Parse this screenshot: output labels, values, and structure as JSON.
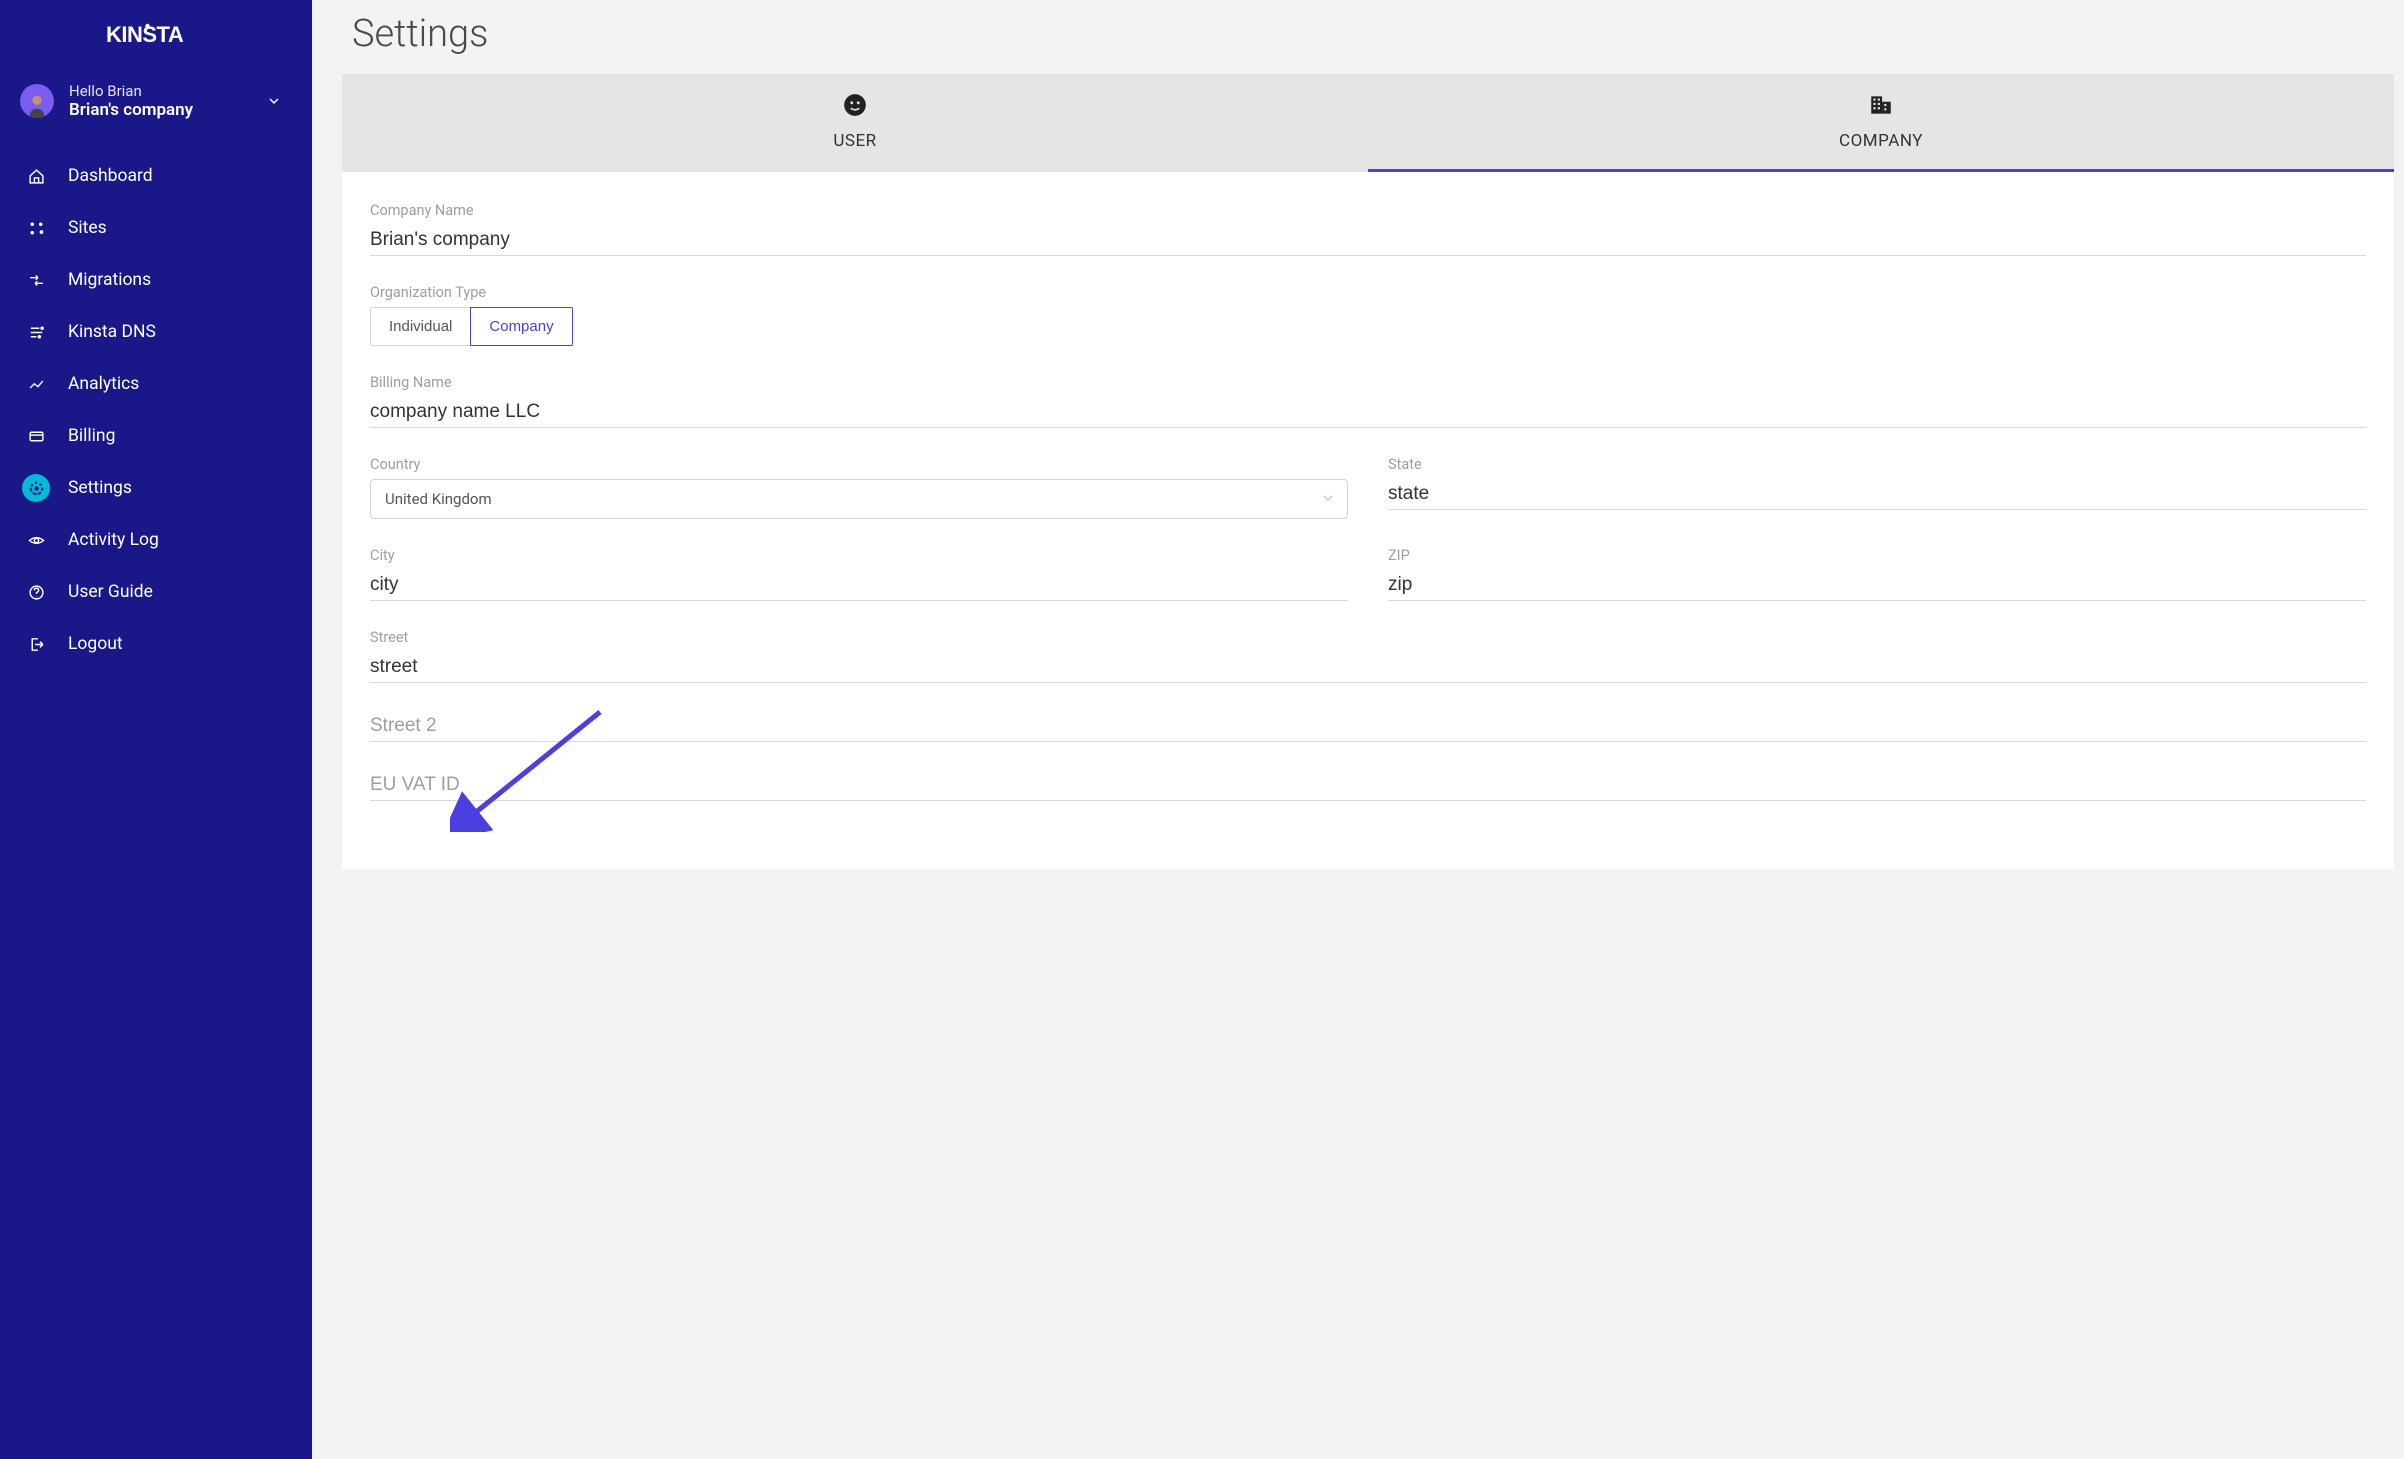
{
  "logo_text": "KINSTA",
  "user": {
    "greeting": "Hello Brian",
    "company": "Brian's company"
  },
  "nav": {
    "dashboard": "Dashboard",
    "sites": "Sites",
    "migrations": "Migrations",
    "dns": "Kinsta DNS",
    "analytics": "Analytics",
    "billing": "Billing",
    "settings": "Settings",
    "activity": "Activity Log",
    "guide": "User Guide",
    "logout": "Logout"
  },
  "page_title": "Settings",
  "tabs": {
    "user": "USER",
    "company": "COMPANY"
  },
  "form": {
    "company_name_label": "Company Name",
    "company_name_value": "Brian's company",
    "org_type_label": "Organization Type",
    "org_type_individual": "Individual",
    "org_type_company": "Company",
    "billing_name_label": "Billing Name",
    "billing_name_value": "company name LLC",
    "country_label": "Country",
    "country_value": "United Kingdom",
    "state_label": "State",
    "state_value": "state",
    "city_label": "City",
    "city_value": "city",
    "zip_label": "ZIP",
    "zip_value": "zip",
    "street_label": "Street",
    "street_value": "street",
    "street2_placeholder": "Street 2",
    "vat_placeholder": "EU VAT ID"
  }
}
